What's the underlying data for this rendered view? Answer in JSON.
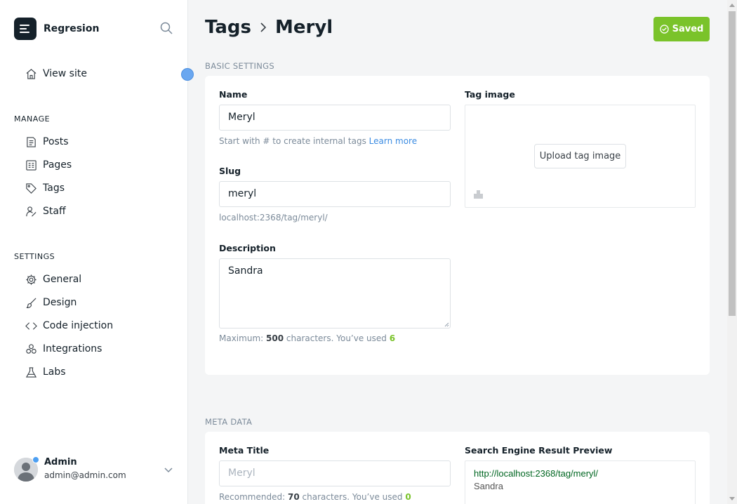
{
  "sidebar": {
    "brand": "Regresion",
    "view_site": "View site",
    "manage_label": "MANAGE",
    "manage_items": [
      "Posts",
      "Pages",
      "Tags",
      "Staff"
    ],
    "settings_label": "SETTINGS",
    "settings_items": [
      "General",
      "Design",
      "Code injection",
      "Integrations",
      "Labs"
    ],
    "user": {
      "name": "Admin",
      "email": "admin@admin.com"
    }
  },
  "header": {
    "breadcrumb_parent": "Tags",
    "breadcrumb_current": "Meryl",
    "saved_label": "Saved"
  },
  "basic": {
    "section_title": "BASIC SETTINGS",
    "name_label": "Name",
    "name_value": "Meryl",
    "name_hint": "Start with # to create internal tags",
    "learn_more": "Learn more",
    "slug_label": "Slug",
    "slug_value": "meryl",
    "slug_url": "localhost:2368/tag/meryl/",
    "description_label": "Description",
    "description_value": "Sandra",
    "desc_hint_prefix": "Maximum:",
    "desc_max": "500",
    "desc_hint_mid": "characters. You’ve used",
    "desc_used": "6",
    "tag_image_label": "Tag image",
    "upload_label": "Upload tag image"
  },
  "meta": {
    "section_title": "META DATA",
    "meta_title_label": "Meta Title",
    "meta_title_placeholder": "Meryl",
    "hint_prefix": "Recommended:",
    "hint_count": "70",
    "hint_mid": "characters. You’ve used",
    "hint_used": "0",
    "serp_label": "Search Engine Result Preview",
    "serp_url": "http://localhost:2368/tag/meryl/",
    "serp_desc": "Sandra"
  },
  "colors": {
    "accent_green": "#7ac32a",
    "link_blue": "#3a8be2"
  }
}
